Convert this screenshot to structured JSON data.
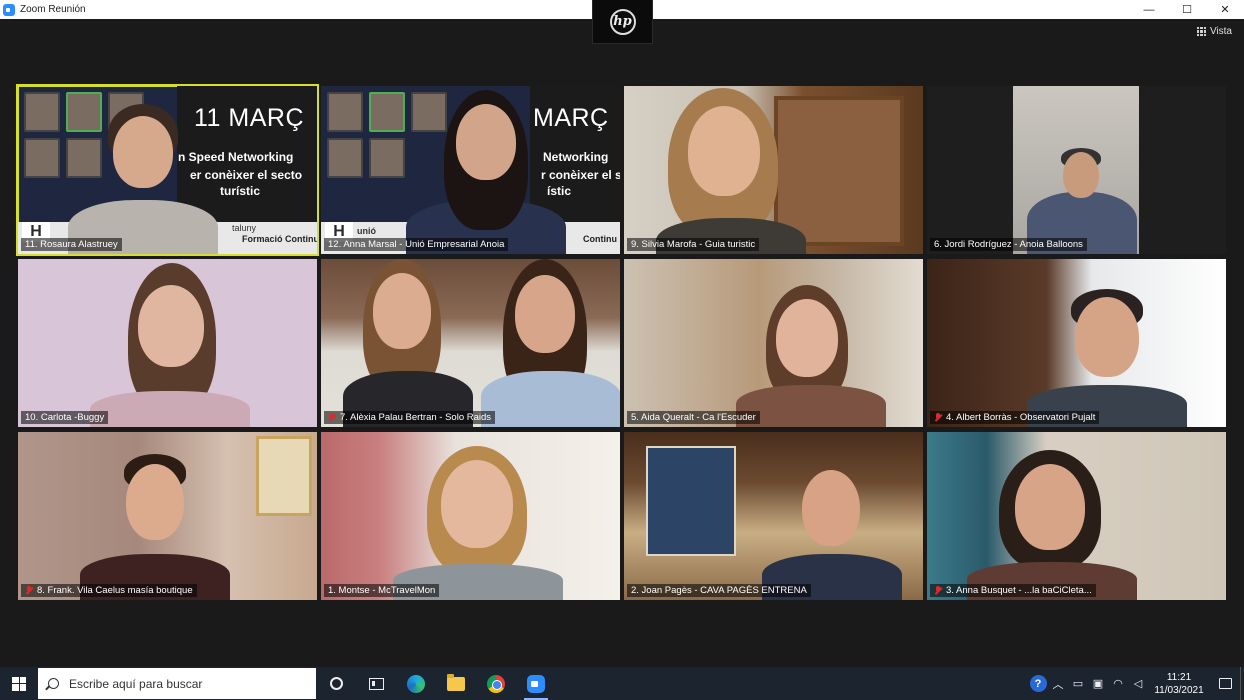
{
  "window": {
    "title": "Zoom Reunión",
    "controls": {
      "minimize": "—",
      "maximize": "☐",
      "close": "✕"
    }
  },
  "notch": {
    "brand": "hp"
  },
  "toolbar": {
    "view_label": "Vista"
  },
  "banner": {
    "date": "11 MARÇ",
    "line1": "n Speed Networking",
    "line2a": "er conèixer el ",
    "line2b": "secto",
    "line3": "turístic",
    "tile2_line1": "Networking",
    "tile2_line2a": "r conèixer el ",
    "tile2_line2b": "secto",
    "tile2_line3": "ístic",
    "footer_org": "taluny",
    "footer_org2": "unió",
    "footer_text": "Formació Continu",
    "footer_text2": "Continu"
  },
  "participants": [
    {
      "name": "11. Rosaura Alastruey",
      "muted": false,
      "active": true
    },
    {
      "name": "12. Anna Marsal - Unió Empresarial Anoia",
      "muted": false,
      "active": false
    },
    {
      "name": "9. Silvia Marofa - Guia turistic",
      "muted": false,
      "active": false
    },
    {
      "name": "6. Jordi Rodríguez - Anoia Balloons",
      "muted": false,
      "active": false
    },
    {
      "name": "10. Carlota -Buggy",
      "muted": false,
      "active": false
    },
    {
      "name": "7. Alèxia Palau Bertran - Solo Raids",
      "muted": true,
      "active": false
    },
    {
      "name": "5. Aida Queralt - Ca l'Escuder",
      "muted": false,
      "active": false
    },
    {
      "name": "4. Albert Borràs - Observatori Pujalt",
      "muted": true,
      "active": false
    },
    {
      "name": "8. Frank. Vila Caelus masía boutique",
      "muted": true,
      "active": false
    },
    {
      "name": "1. Montse - McTravelMon",
      "muted": false,
      "active": false
    },
    {
      "name": "2. Joan Pagès - CAVA PAGÈS ENTRENA",
      "muted": false,
      "active": false
    },
    {
      "name": "3. Anna Busquet - ...la baCiCleta...",
      "muted": true,
      "active": false
    }
  ],
  "taskbar": {
    "search_placeholder": "Escribe aquí para buscar",
    "apps": [
      "cortana-icon",
      "task-view-icon",
      "edge-icon",
      "file-explorer-icon",
      "chrome-icon",
      "zoom-icon"
    ],
    "clock_time": "11:21",
    "clock_date": "11/03/2021",
    "help": "?"
  },
  "colors": {
    "active_speaker": "#d6e02a",
    "muted_mic": "#e02828",
    "taskbar": "#1c2430",
    "gallery_bg": "#1a1a1a"
  }
}
